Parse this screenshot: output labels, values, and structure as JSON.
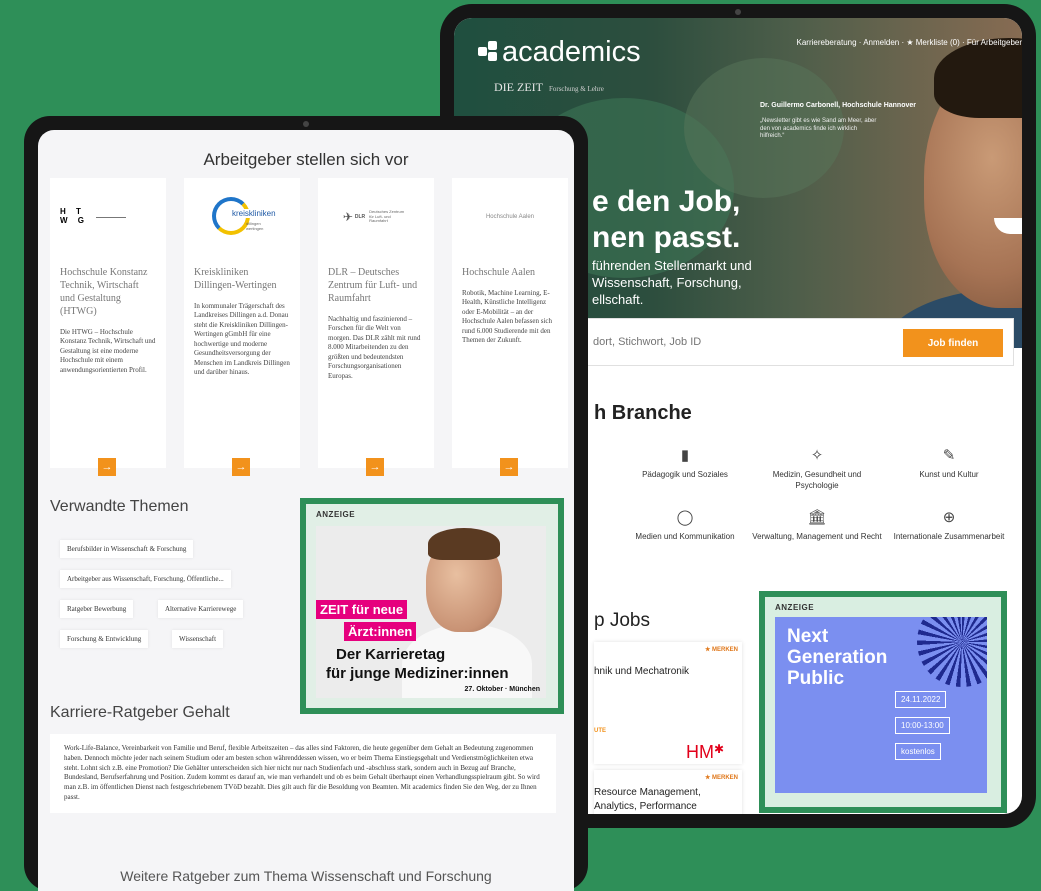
{
  "back_tablet": {
    "logo_text": "academics",
    "zeit_brand": "DIE ZEIT",
    "zeit_sub": "Forschung & Lehre",
    "nav": "Karriereberatung · Anmelden · ★ Merkliste (0) · Für Arbeitgeber",
    "quote_name": "Dr. Guillermo Carbonell, Hochschule Hannover",
    "quote_text": "„Newsletter gibt es wie Sand am Meer, aber den von academics finde ich wirklich hilfreich.“",
    "hero_line1": "e den Job,",
    "hero_line2": "nen passt.",
    "hero_sub": "führenden Stellenmarkt und Wissenschaft, Forschung, ellschaft.",
    "search_placeholder": "dort, Stichwort, Job ID",
    "search_button": "Job finden",
    "branche_title": "h Branche",
    "categories": [
      {
        "label": "Pädagogik und Soziales",
        "icon": "book-icon",
        "glyph": "▮"
      },
      {
        "label": "Medizin, Gesundheit und Psychologie",
        "icon": "dna-icon",
        "glyph": "✧"
      },
      {
        "label": "Kunst und Kultur",
        "icon": "brush-icon",
        "glyph": "✎"
      },
      {
        "label": "Medien und Kommunikation",
        "icon": "speech-bubble-icon",
        "glyph": "◯"
      },
      {
        "label": "Verwaltung, Management und Recht",
        "icon": "courthouse-icon",
        "glyph": "🏛"
      },
      {
        "label": "Internationale Zusammenarbeit",
        "icon": "globe-icon",
        "glyph": "⊕"
      }
    ],
    "jobs_title": "p Jobs",
    "job1_title": "hnik und Mechatronik",
    "job1_merken": "★ MERKEN",
    "job1_label": "UTE",
    "job1_company": "HM",
    "job2_merken": "★ MERKEN",
    "job2_title": "Resource Management, Analytics, Performance",
    "ad": {
      "label": "ANZEIGE",
      "title": "Next Generation Public",
      "date": "24.11.2022",
      "time": "10:00-13:00",
      "price": "kostenlos"
    }
  },
  "front_tablet": {
    "employers_title": "Arbeitgeber stellen sich vor",
    "employers": [
      {
        "logo_text": "H T W G",
        "name": "Hochschule Konstanz Technik, Wirtschaft und Gestaltung (HTWG)",
        "desc": "Die HTWG – Hochschule Konstanz Technik, Wirtschaft und Gestaltung ist eine moderne Hochschule mit einem anwendungsorientierten Profil."
      },
      {
        "logo_text": "kreiskliniken",
        "logo_sub": "dillingen wertingen",
        "name": "Kreiskliniken Dillingen-Wertingen",
        "desc": "In kommunaler Trägerschaft des Landkreises Dillingen a.d. Donau steht die Kreiskliniken Dillingen-Wertingen gGmbH für eine hochwertige und moderne Gesundheitsversorgung der Menschen im Landkreis Dillingen und darüber hinaus."
      },
      {
        "logo_text": "DLR",
        "logo_sub": "Deutsches Zentrum für Luft- und Raumfahrt",
        "name": "DLR – Deutsches Zentrum für Luft- und Raumfahrt",
        "desc": "Nachhaltig und faszinierend – Forschen für die Welt von morgen. Das DLR zählt mit rund 8.000 Mitarbeitenden zu den größten und bedeutendsten Forschungsorganisationen Europas."
      },
      {
        "logo_text": "Hochschule Aalen",
        "name": "Hochschule Aalen",
        "desc": "Robotik, Machine Learning, E-Health, Künstliche Intelligenz oder E-Mobilität – an der Hochschule Aalen befassen sich rund 6.000 Studierende mit den Themen der Zukunft."
      }
    ],
    "arrow_glyph": "→",
    "related_title": "Verwandte Themen",
    "tags": [
      "Berufsbilder in Wissenschaft & Forschung",
      "Arbeitgeber aus Wissenschaft, Forschung, Öffentliche...",
      "Ratgeber Bewerbung",
      "Alternative Karrierewege",
      "Forschung & Entwicklung",
      "Wissenschaft"
    ],
    "ad": {
      "label": "ANZEIGE",
      "pink1": "ZEIT für neue",
      "pink2": "Ärzt:innen",
      "head1": "Der Karrieretag",
      "head2": "für junge Mediziner:innen",
      "date": "27. Oktober · München"
    },
    "career_title": "Karriere-Ratgeber Gehalt",
    "career_text": "Work-Life-Balance, Vereinbarkeit von Familie und Beruf, flexible Arbeitszeiten – das alles sind Faktoren, die heute gegenüber dem Gehalt an Bedeutung zugenommen haben. Dennoch möchte jeder nach seinem Studium oder am besten schon währenddessen wissen, wo er beim Thema Einstiegsgehalt und Verdienstmöglichkeiten etwa steht. Lohnt sich z.B. eine Promotion? Die Gehälter unterscheiden sich hier nicht nur nach Studienfach und -abschluss stark, sondern auch in Bezug auf Branche, Bundesland, Berufserfahrung und Position. Zudem kommt es darauf an, wie man verhandelt und ob es beim Gehalt überhaupt einen Verhandlungsspielraum gibt. So wird man z.B. im öffentlichen Dienst nach festgeschriebenem TVöD bezahlt. Dies gilt auch für die Besoldung von Beamten. Mit academics finden Sie den Weg, der zu Ihnen passt.",
    "more_title": "Weitere Ratgeber zum Thema Wissenschaft und Forschung"
  }
}
